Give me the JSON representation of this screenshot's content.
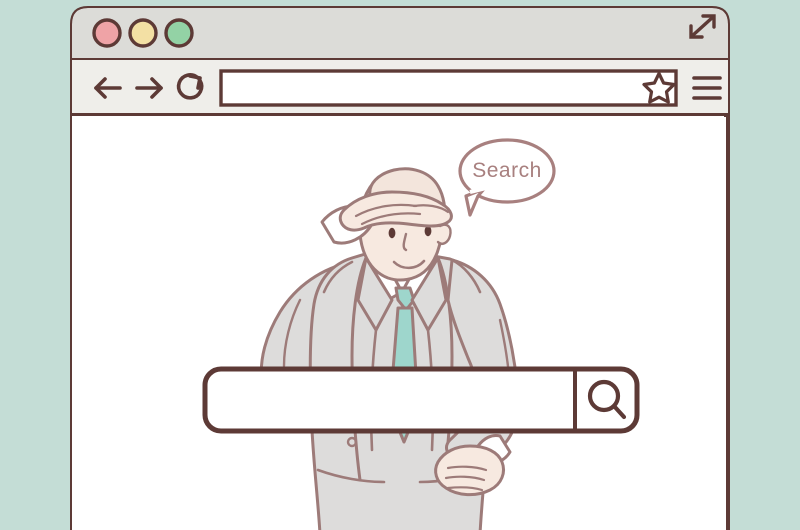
{
  "scene": {
    "description": "Flat line illustration of a browser window with a businessman shielding his eyes looking out, a Search speech bubble, and a large search bar",
    "background_color": "#c4ddd6"
  },
  "palette": {
    "background": "#c4ddd6",
    "outline": "#5d3a36",
    "titlebar": "#dcdcd8",
    "toolbar": "#efeeea",
    "page": "#ffffff",
    "url_field": "#ffffff",
    "dot_red": "#efa3a6",
    "dot_yellow": "#f3e0a4",
    "dot_green": "#93d2a5",
    "suit": "#dddcdb",
    "suit_line": "#9d7b79",
    "skin": "#f7e9e0",
    "skin_line": "#9d7b79",
    "shirt": "#ffffff",
    "tie": "#9ed6cc",
    "bubble_line": "#a8807f",
    "bubble_text": "#a8807f",
    "hair": "#f3e5dc"
  },
  "browser": {
    "titlebar": {
      "traffic_lights": [
        {
          "name": "close",
          "color": "#efa3a6"
        },
        {
          "name": "minimize",
          "color": "#f3e0a4"
        },
        {
          "name": "maximize",
          "color": "#93d2a5"
        }
      ],
      "expand_icon": "expand-arrows-icon"
    },
    "toolbar": {
      "back_icon": "back-arrow-icon",
      "forward_icon": "forward-arrow-icon",
      "reload_icon": "reload-icon",
      "bookmark_icon": "star-icon",
      "menu_icon": "hamburger-menu-icon",
      "url_value": "",
      "url_placeholder": ""
    }
  },
  "page_content": {
    "speech_bubble": {
      "text": "Search"
    },
    "search_bar": {
      "input_value": "",
      "input_placeholder": "",
      "button_icon": "magnifier-icon"
    },
    "character": {
      "pose": "hand-shading-eyes-looking-out",
      "attire": "gray-suit-white-shirt-teal-tie"
    }
  }
}
